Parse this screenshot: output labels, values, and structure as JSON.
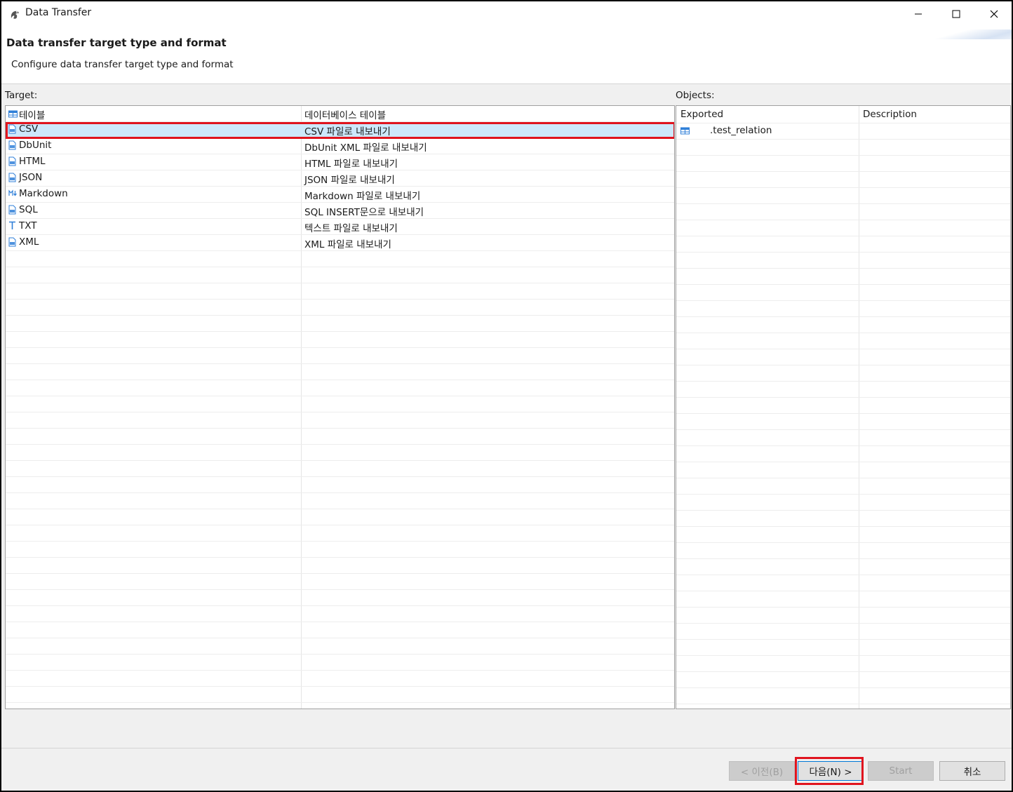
{
  "window": {
    "title": "Data Transfer"
  },
  "header": {
    "title": "Data transfer target type and format",
    "description": "Configure data transfer target type and format"
  },
  "target": {
    "label": "Target:",
    "rows": [
      {
        "name": "테이블",
        "description": "데이터베이스 테이블",
        "icon": "table-icon"
      },
      {
        "name": "CSV",
        "description": "CSV 파일로 내보내기",
        "icon": "file-icon",
        "selected": true
      },
      {
        "name": "DbUnit",
        "description": "DbUnit XML 파일로 내보내기",
        "icon": "file-icon"
      },
      {
        "name": "HTML",
        "description": "HTML 파일로 내보내기",
        "icon": "file-icon"
      },
      {
        "name": "JSON",
        "description": "JSON 파일로 내보내기",
        "icon": "file-icon"
      },
      {
        "name": "Markdown",
        "description": "Markdown 파일로 내보내기",
        "icon": "markdown-icon"
      },
      {
        "name": "SQL",
        "description": "SQL INSERT문으로 내보내기",
        "icon": "file-icon"
      },
      {
        "name": "TXT",
        "description": "텍스트 파일로 내보내기",
        "icon": "text-icon"
      },
      {
        "name": "XML",
        "description": "XML 파일로 내보내기",
        "icon": "file-icon"
      }
    ]
  },
  "objects": {
    "label": "Objects:",
    "columns": [
      "Exported",
      "Description"
    ],
    "rows": [
      {
        "name": ".test_relation",
        "description": "",
        "icon": "table-icon"
      }
    ]
  },
  "buttons": {
    "back": "< 이전(B)",
    "next": "다음(N) >",
    "start": "Start",
    "cancel": "취소"
  },
  "colors": {
    "selection": "#cde8fb",
    "highlight": "#e0141e",
    "icon": "#2f7fd8"
  }
}
